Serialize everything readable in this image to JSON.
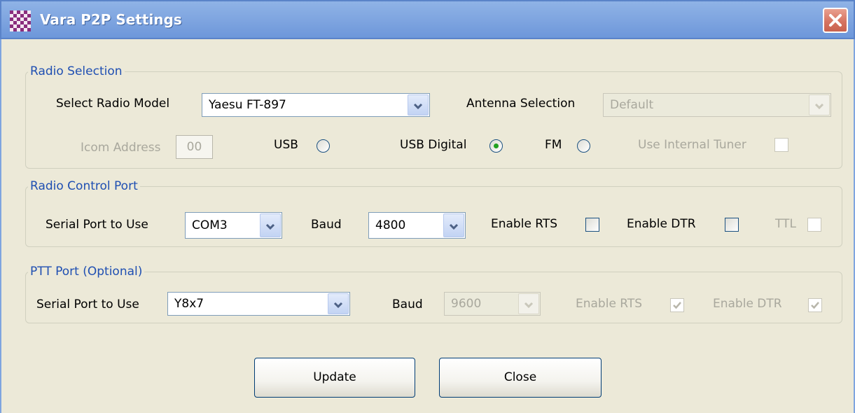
{
  "window": {
    "title": "Vara P2P Settings"
  },
  "radio_selection": {
    "legend": "Radio Selection",
    "model_label": "Select Radio Model",
    "model_value": "Yaesu FT-897",
    "antenna_label": "Antenna Selection",
    "antenna_value": "Default",
    "icom_label": "Icom Address",
    "icom_value": "00",
    "usb_label": "USB",
    "usb_digital_label": "USB Digital",
    "fm_label": "FM",
    "tuner_label": "Use Internal Tuner",
    "selected_mode": "USB Digital"
  },
  "radio_control": {
    "legend": "Radio Control Port",
    "port_label": "Serial Port to Use",
    "port_value": "COM3",
    "baud_label": "Baud",
    "baud_value": "4800",
    "rts_label": "Enable RTS",
    "dtr_label": "Enable DTR",
    "ttl_label": "TTL"
  },
  "ptt": {
    "legend": "PTT Port (Optional)",
    "port_label": "Serial Port to Use",
    "port_value": "Y8x7",
    "baud_label": "Baud",
    "baud_value": "9600",
    "rts_label": "Enable RTS",
    "dtr_label": "Enable DTR"
  },
  "buttons": {
    "update": "Update",
    "close": "Close"
  },
  "colors": {
    "legend": "#1f4fb2",
    "titlebar": "#7fa5e0",
    "close_button": "#d67462",
    "radio_selected": "#21a121"
  }
}
